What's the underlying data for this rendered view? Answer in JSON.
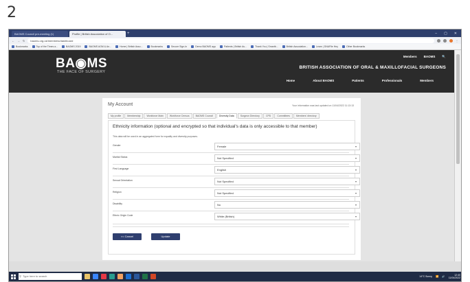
{
  "page_number": "2",
  "browser": {
    "tabs": [
      {
        "label": "BAOMS Council pre-meeting (1)",
        "active": false
      },
      {
        "label": "Profile | British Association of O...",
        "active": true
      }
    ],
    "new_tab": "+",
    "window_controls": [
      "–",
      "▢",
      "✕"
    ],
    "url": "baoms.org.uk/members/dashboard",
    "bookmarks": [
      "Bookmarks",
      "Top of the Times a...",
      "BAOMS 2019",
      "BAOMS AGM & An...",
      "Home | British Asso...",
      "Bookmarks",
      "Secure Sign-In",
      "Demo BAOMS app",
      "Patients | British As...",
      "Thank You | Smartb...",
      "British Association...",
      "Learn | DNAFile Hey",
      "Other Bookmarks"
    ]
  },
  "site": {
    "logo": "BA◉MS",
    "tagline": "THE FACE OF SURGERY",
    "top_links": [
      "Members",
      "BAOMS",
      "🔍"
    ],
    "org_name": "BRITISH ASSOCIATION OF ORAL & MAXILLOFACIAL SURGEONS",
    "nav": [
      "Home",
      "About BAOMS",
      "Patients",
      "Professionals",
      "Members"
    ]
  },
  "account": {
    "title": "My Account",
    "last_updated": "Your information was last updated on 11/04/2022 11:13:13",
    "subtabs": [
      {
        "label": "My profile",
        "active": false
      },
      {
        "label": "Membership",
        "active": false
      },
      {
        "label": "Workforce Main",
        "active": false
      },
      {
        "label": "Workforce Census",
        "active": false
      },
      {
        "label": "BAOMS Council",
        "active": false
      },
      {
        "label": "Diversity Data",
        "active": true
      },
      {
        "label": "Surgeon Directory",
        "active": false
      },
      {
        "label": "CPD",
        "active": false
      },
      {
        "label": "Committees",
        "active": false
      },
      {
        "label": "Members' directory",
        "active": false
      }
    ],
    "heading": "Ethnicity information (optional and encrypted so that individual's data is only accessible to that member)",
    "note": "This data will be used in an aggregated form for equality and diversity purposes.",
    "fields": [
      {
        "label": "Gender",
        "value": "Female"
      },
      {
        "label": "Marital Status",
        "value": "Not Specified"
      },
      {
        "label": "First Language",
        "value": "English"
      },
      {
        "label": "Sexual Orientation",
        "value": "Not Specified"
      },
      {
        "label": "Religion",
        "value": "Not Specified"
      },
      {
        "label": "Disability",
        "value": "No"
      },
      {
        "label": "Ethnic Origin Code",
        "value": "White (British)"
      }
    ],
    "cancel_label": "<< Cancel",
    "update_label": "Update"
  },
  "taskbar": {
    "search_placeholder": "Type here to search",
    "weather": "14°C Sunny",
    "time": "12:40",
    "date": "11/04/2022"
  }
}
